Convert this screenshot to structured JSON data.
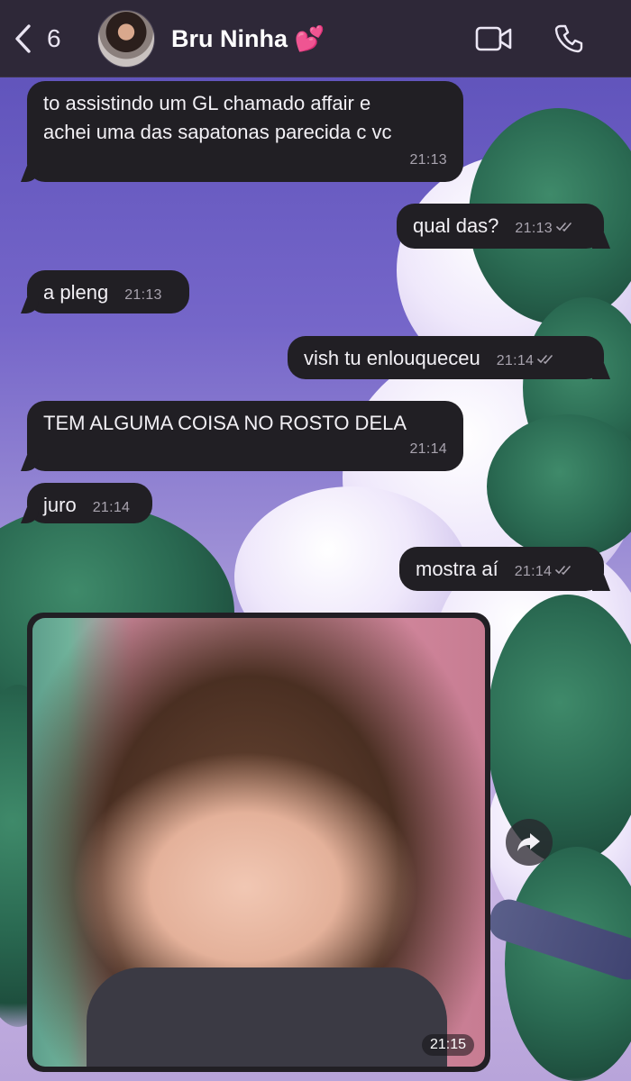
{
  "header": {
    "back_count": "6",
    "contact_name": "Bru Ninha 💕"
  },
  "messages": [
    {
      "direction": "in",
      "text_line1": "to assistindo um GL chamado affair e",
      "text_line2": "achei uma das sapatonas parecida c vc",
      "time": "21:13"
    },
    {
      "direction": "out",
      "text": "qual das?",
      "time": "21:13"
    },
    {
      "direction": "in",
      "text": "a pleng",
      "time": "21:13"
    },
    {
      "direction": "out",
      "text": "vish tu enlouqueceu",
      "time": "21:14"
    },
    {
      "direction": "in",
      "text": "TEM ALGUMA COISA NO ROSTO DELA",
      "time": "21:14"
    },
    {
      "direction": "in",
      "text": "juro",
      "time": "21:14"
    },
    {
      "direction": "out",
      "text": "mostra aí",
      "time": "21:14"
    }
  ],
  "photo_message": {
    "time": "21:15"
  },
  "colors": {
    "header_bg": "#2e2838",
    "bubble_bg": "#211f24",
    "text": "#f2f0f5",
    "time": "#a8a3ae"
  }
}
